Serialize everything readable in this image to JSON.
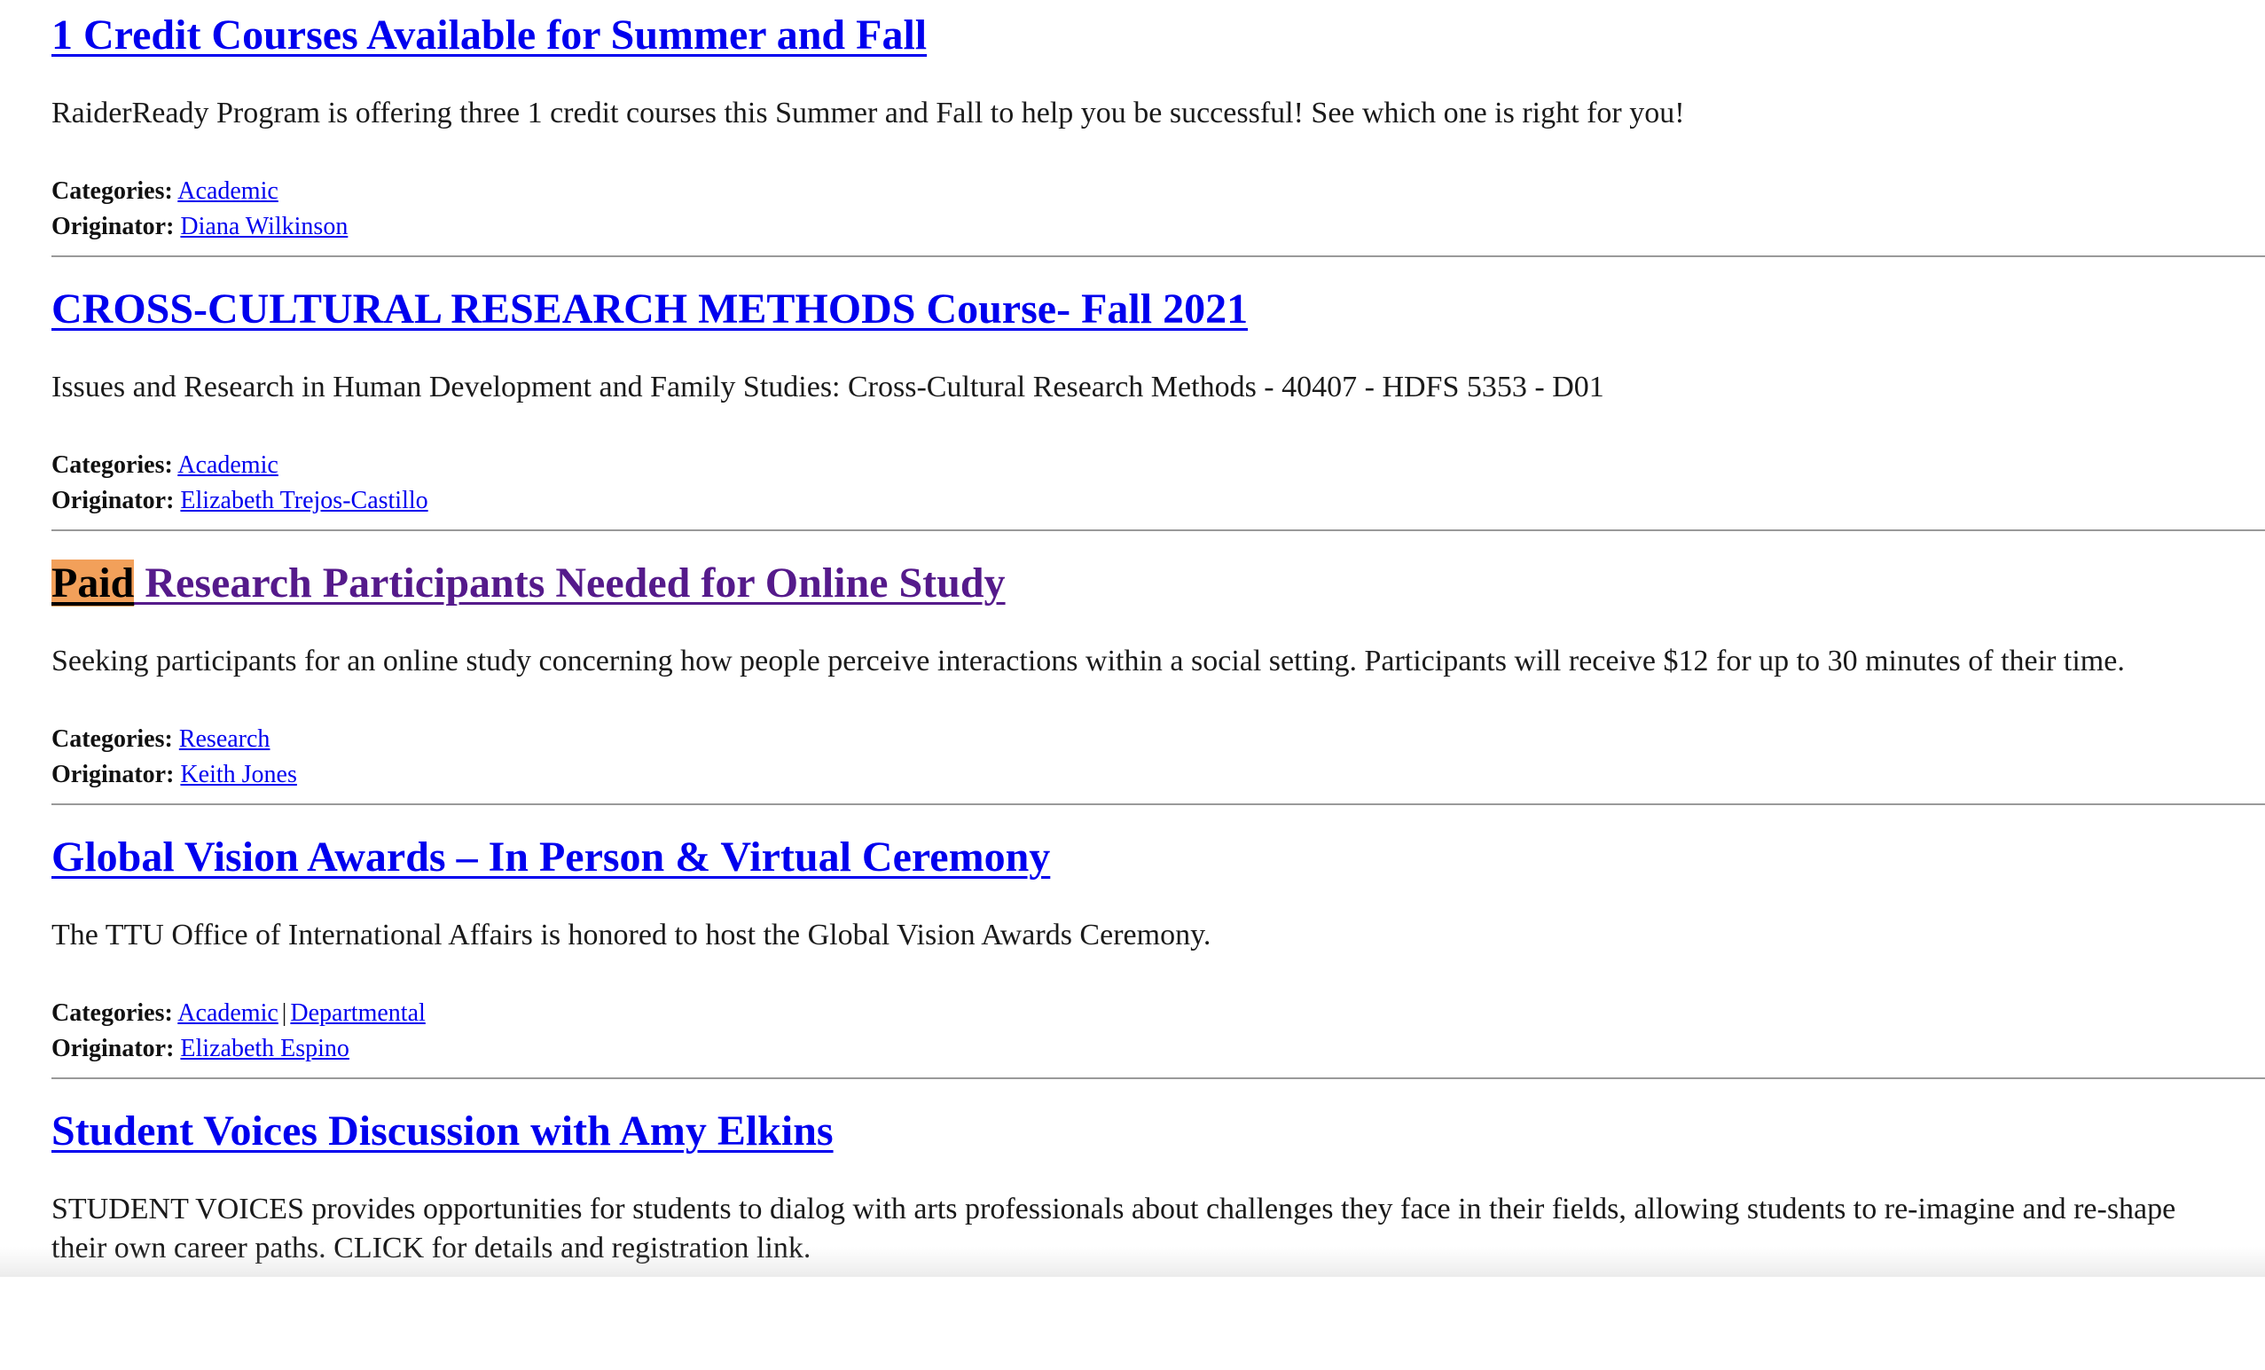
{
  "posts": [
    {
      "title": "1 Credit Courses Available for Summer and Fall",
      "description": "RaiderReady Program is offering three 1 credit courses this Summer and Fall to help you be successful! See which one is right for you!",
      "categories_label": "Categories:",
      "categories": [
        "Academic"
      ],
      "originator_label": "Originator:",
      "originator": "Diana Wilkinson"
    },
    {
      "title": "CROSS-CULTURAL RESEARCH METHODS Course- Fall 2021",
      "description": "Issues and Research in Human Development and Family Studies: Cross-Cultural Research Methods - 40407 - HDFS 5353 - D01",
      "categories_label": "Categories:",
      "categories": [
        "Academic"
      ],
      "originator_label": "Originator:",
      "originator": "Elizabeth Trejos-Castillo"
    },
    {
      "title_highlight": "Paid",
      "title": " Research Participants Needed for Online Study",
      "description": "Seeking participants for an online study concerning how people perceive interactions within a social setting. Participants will receive $12 for up to 30 minutes of their time.",
      "categories_label": "Categories:",
      "categories": [
        "Research"
      ],
      "originator_label": "Originator:",
      "originator": "Keith Jones"
    },
    {
      "title": "Global Vision Awards – In Person & Virtual Ceremony",
      "description": "The TTU Office of International Affairs is honored to host the Global Vision Awards Ceremony.",
      "categories_label": "Categories:",
      "categories": [
        "Academic",
        "Departmental"
      ],
      "category_separator": "|",
      "originator_label": "Originator:",
      "originator": "Elizabeth Espino"
    },
    {
      "title": "Student Voices Discussion with Amy Elkins",
      "description": "STUDENT VOICES provides opportunities for students to dialog with arts professionals about challenges they face in their fields, allowing students to re-imagine and re-shape their own career paths. CLICK for details and registration link."
    }
  ],
  "colors": {
    "link": "#0000ee",
    "visited_link": "#551a8b",
    "search_highlight": "#f2a05a",
    "divider": "#9a9a9a"
  }
}
